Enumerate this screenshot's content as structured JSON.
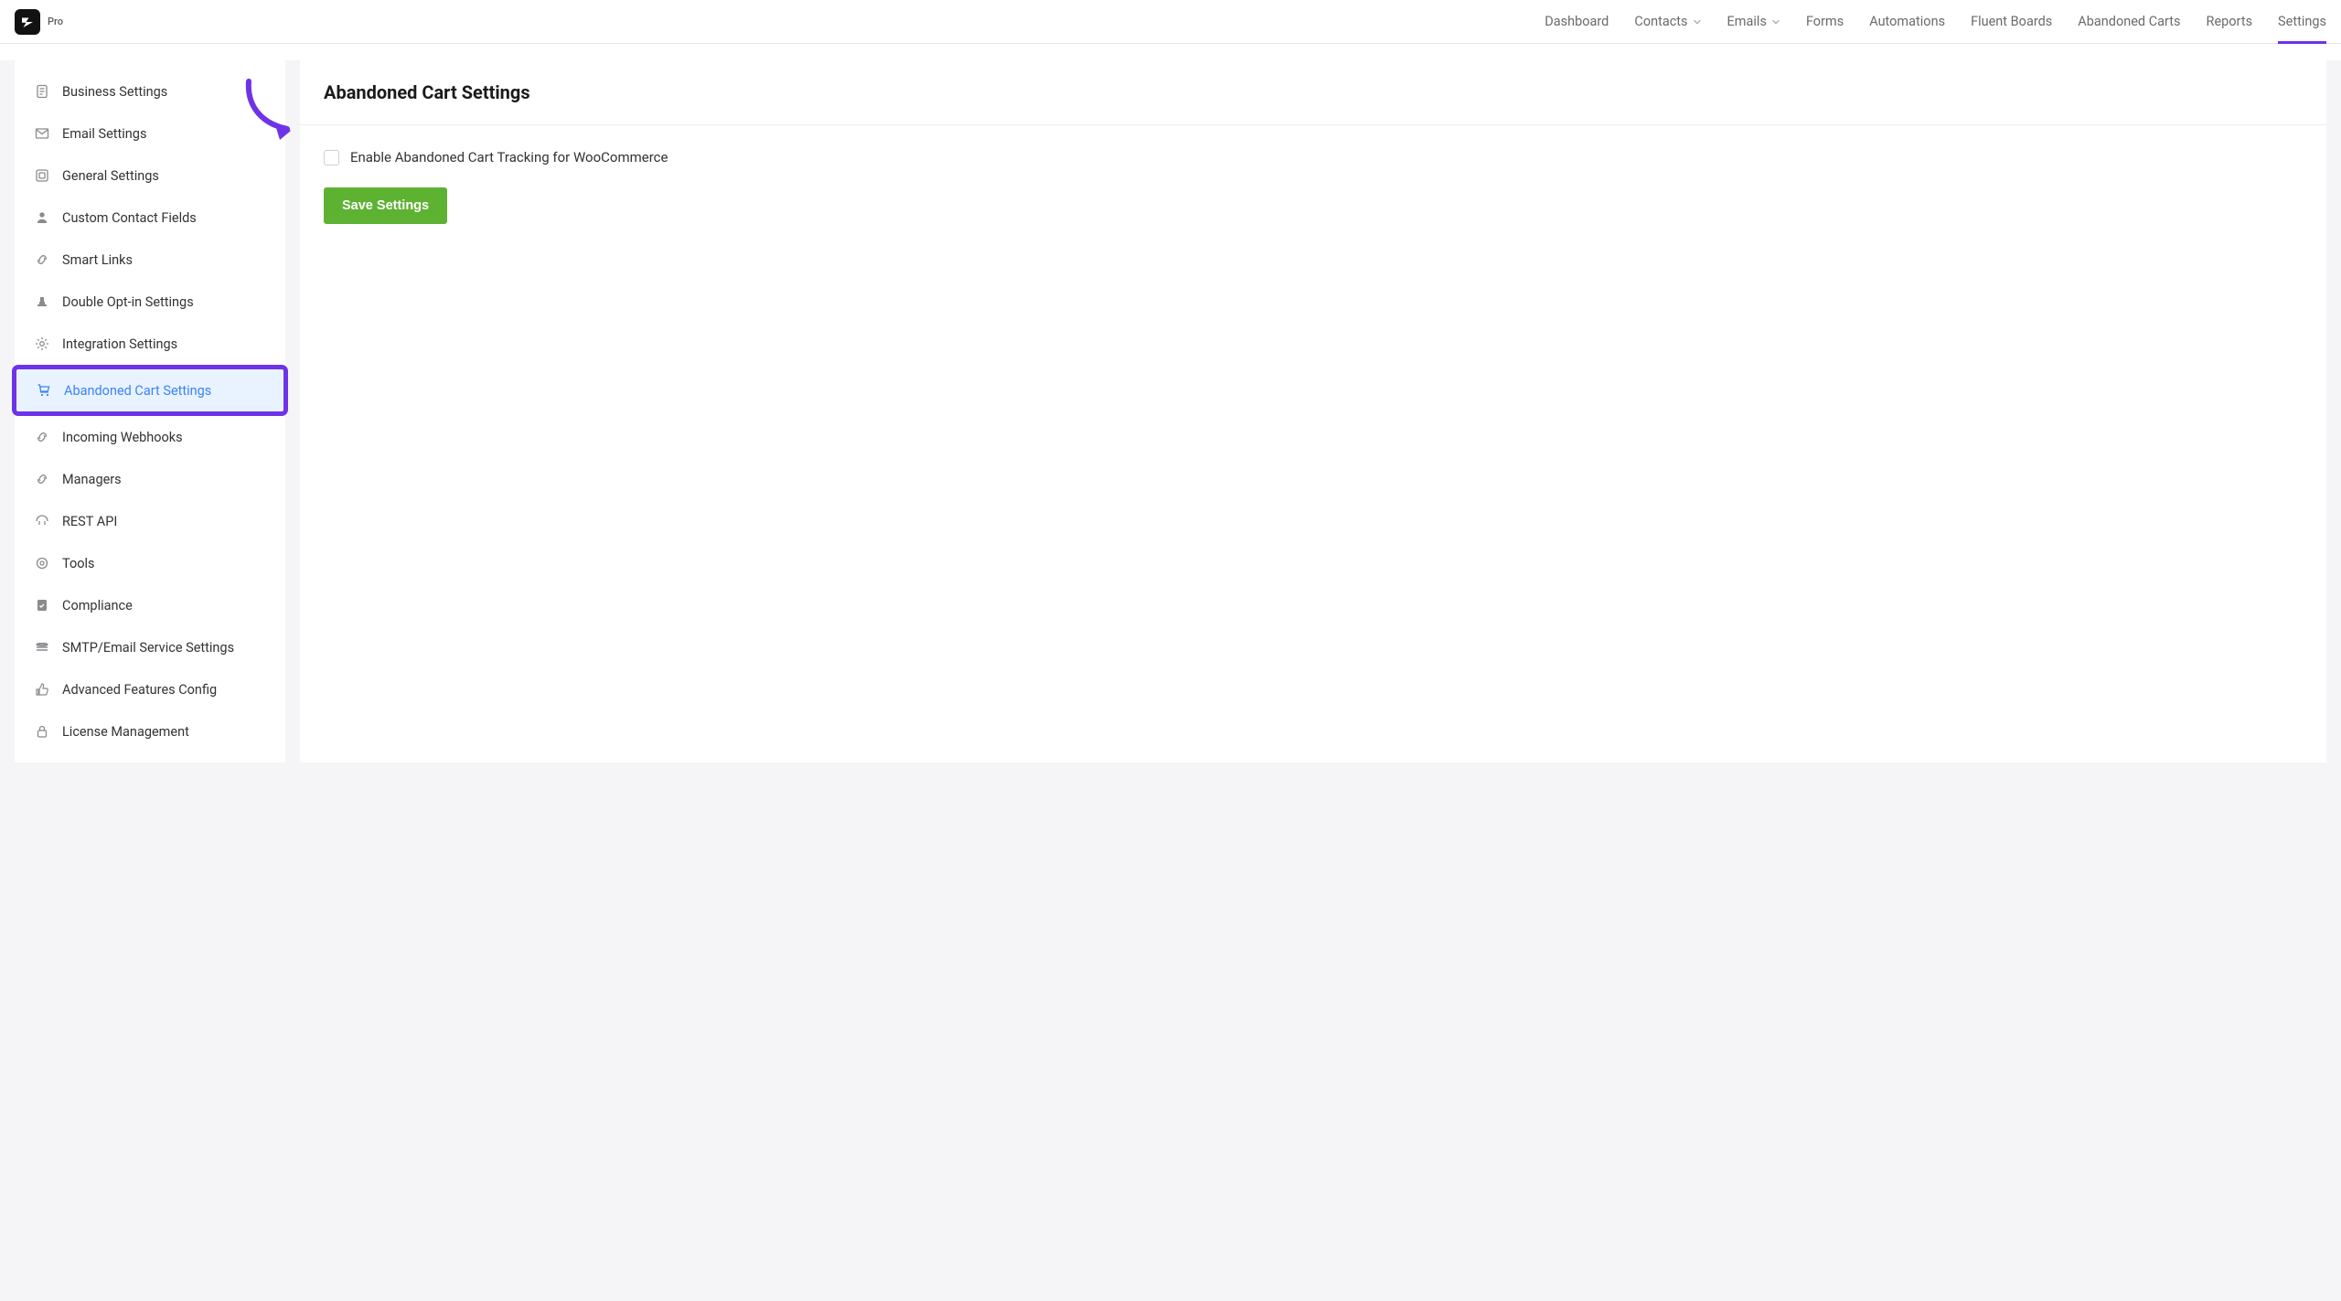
{
  "logo": {
    "badge": "Pro"
  },
  "nav": {
    "items": [
      {
        "label": "Dashboard",
        "dropdown": false
      },
      {
        "label": "Contacts",
        "dropdown": true
      },
      {
        "label": "Emails",
        "dropdown": true
      },
      {
        "label": "Forms",
        "dropdown": false
      },
      {
        "label": "Automations",
        "dropdown": false
      },
      {
        "label": "Fluent Boards",
        "dropdown": false
      },
      {
        "label": "Abandoned Carts",
        "dropdown": false
      },
      {
        "label": "Reports",
        "dropdown": false
      },
      {
        "label": "Settings",
        "dropdown": false,
        "active": true
      }
    ]
  },
  "sidebar": {
    "items": [
      {
        "label": "Business Settings",
        "icon": "document-icon"
      },
      {
        "label": "Email Settings",
        "icon": "mail-icon"
      },
      {
        "label": "General Settings",
        "icon": "square-icon"
      },
      {
        "label": "Custom Contact Fields",
        "icon": "person-icon"
      },
      {
        "label": "Smart Links",
        "icon": "link-icon"
      },
      {
        "label": "Double Opt-in Settings",
        "icon": "stamp-icon"
      },
      {
        "label": "Integration Settings",
        "icon": "gear-icon"
      },
      {
        "label": "Abandoned Cart Settings",
        "icon": "cart-icon",
        "active": true
      },
      {
        "label": "Incoming Webhooks",
        "icon": "link-icon"
      },
      {
        "label": "Managers",
        "icon": "link-icon"
      },
      {
        "label": "REST API",
        "icon": "api-icon"
      },
      {
        "label": "Tools",
        "icon": "cog-icon"
      },
      {
        "label": "Compliance",
        "icon": "clipboard-check-icon"
      },
      {
        "label": "SMTP/Email Service Settings",
        "icon": "stack-icon"
      },
      {
        "label": "Advanced Features Config",
        "icon": "thumbs-up-icon"
      },
      {
        "label": "License Management",
        "icon": "lock-icon"
      }
    ]
  },
  "main": {
    "title": "Abandoned Cart Settings",
    "checkbox_label": "Enable Abandoned Cart Tracking for WooCommerce",
    "checkbox_checked": false,
    "save_label": "Save Settings"
  },
  "colors": {
    "accent": "#6e33e8",
    "success": "#5eb232",
    "active_blue": "#3b82f6"
  },
  "annotation": {
    "arrow_color": "#6e33e8"
  }
}
